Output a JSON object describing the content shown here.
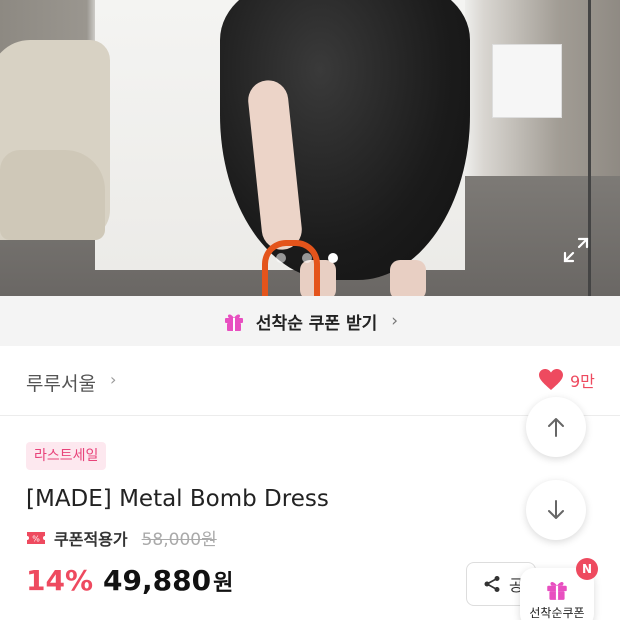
{
  "hero": {
    "slide_count": 3,
    "active_slide": 3
  },
  "coupon_banner": {
    "label": "선착순 쿠폰 받기",
    "icon": "gift-icon"
  },
  "shop": {
    "name": "루루서울",
    "like_count": "9만"
  },
  "product": {
    "badge": "라스트세일",
    "title": "[MADE] Metal Bomb Dress",
    "coupon_label": "쿠폰적용가",
    "original_price": "58,000원",
    "discount": "14%",
    "price": "49,880",
    "currency": "원"
  },
  "floating": {
    "share_label": "공",
    "coupon_label": "선착순쿠폰",
    "coupon_badge": "N"
  },
  "colors": {
    "accent": "#ee4a5f",
    "badge_bg": "#fde8ef",
    "gift": "#e84fc0"
  }
}
